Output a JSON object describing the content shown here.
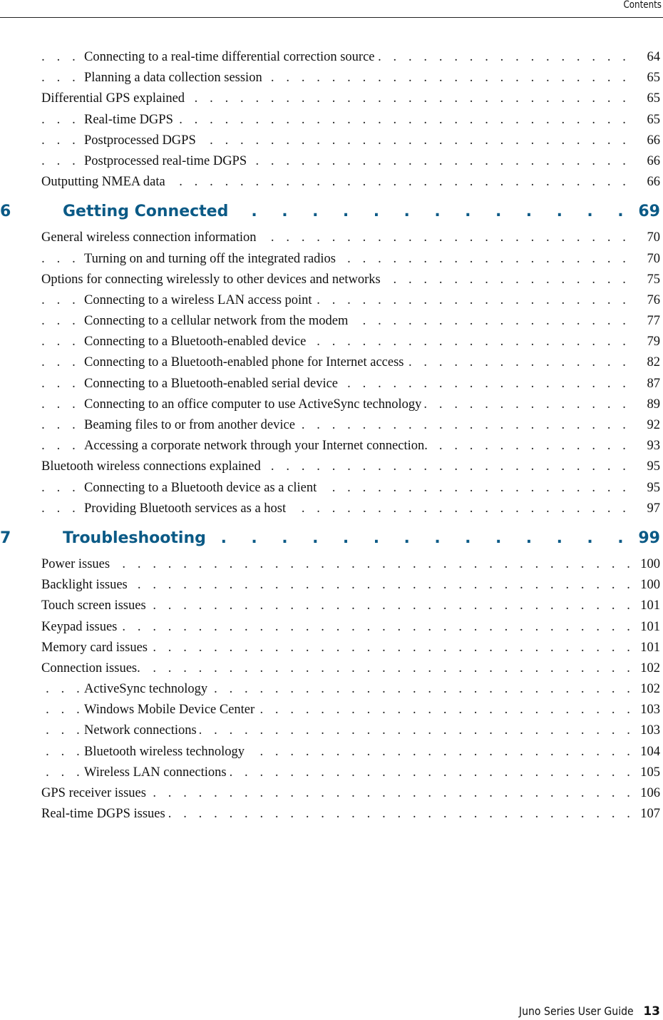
{
  "header": {
    "title": "Contents"
  },
  "toc": {
    "leader_dots": ". . . . . . . . . . . . . . . . . . . . . . . . . . . . . . . . . . . . . . . . . . . . . . . . . . . . . . . . . . . . . . . . . . . . . . . . . . . . . . . . . . . . . . . . .",
    "chapter_leader_dots": ". . . . . . . . . . . . . . . . . . . . . . . . . . . . . . . . . . . . . . . . . .",
    "accent_color": "#0b5a86",
    "pre_entries": [
      {
        "title": "Connecting to a real-time differential correction source",
        "page": "64",
        "level": 2
      },
      {
        "title": "Planning a data collection session",
        "page": "65",
        "level": 2
      },
      {
        "title": "Differential GPS explained",
        "page": "65",
        "level": 1
      },
      {
        "title": "Real-time DGPS",
        "page": "65",
        "level": 2
      },
      {
        "title": "Postprocessed DGPS",
        "page": "66",
        "level": 2
      },
      {
        "title": "Postprocessed real-time DGPS",
        "page": "66",
        "level": 2
      },
      {
        "title": "Outputting NMEA data",
        "page": "66",
        "level": 1
      }
    ],
    "chapters": [
      {
        "number": "6",
        "title": "Getting Connected",
        "page": "69",
        "entries": [
          {
            "title": "General wireless connection information",
            "page": "70",
            "level": 1
          },
          {
            "title": "Turning on and turning off the integrated radios",
            "page": "70",
            "level": 2
          },
          {
            "title": "Options for connecting wirelessly to other devices and networks",
            "page": "75",
            "level": 1
          },
          {
            "title": "Connecting to a wireless LAN access point",
            "page": "76",
            "level": 2
          },
          {
            "title": "Connecting to a cellular network from the modem",
            "page": "77",
            "level": 2
          },
          {
            "title": "Connecting to a Bluetooth-enabled device",
            "page": "79",
            "level": 2
          },
          {
            "title": "Connecting to a Bluetooth-enabled phone for Internet access",
            "page": "82",
            "level": 2
          },
          {
            "title": "Connecting to a Bluetooth-enabled serial device",
            "page": "87",
            "level": 2
          },
          {
            "title": "Connecting to an office computer to use ActiveSync technology",
            "page": "89",
            "level": 2
          },
          {
            "title": "Beaming files to or from another device",
            "page": "92",
            "level": 2
          },
          {
            "title": "Accessing a corporate network through your Internet connection.",
            "page": "93",
            "level": 2
          },
          {
            "title": "Bluetooth wireless connections explained",
            "page": "95",
            "level": 1
          },
          {
            "title": "Connecting to a Bluetooth device as a client",
            "page": "95",
            "level": 2
          },
          {
            "title": "Providing Bluetooth services as a host",
            "page": "97",
            "level": 2
          }
        ]
      },
      {
        "number": "7",
        "title": "Troubleshooting",
        "page": "99",
        "entries": [
          {
            "title": "Power issues",
            "page": "100",
            "level": 1
          },
          {
            "title": "Backlight issues",
            "page": "100",
            "level": 1
          },
          {
            "title": "Touch screen issues",
            "page": "101",
            "level": 1
          },
          {
            "title": "Keypad issues",
            "page": "101",
            "level": 1
          },
          {
            "title": "Memory card issues",
            "page": "101",
            "level": 1
          },
          {
            "title": "Connection issues.",
            "page": "102",
            "level": 1
          },
          {
            "title": "ActiveSync technology",
            "page": "102",
            "level": 2
          },
          {
            "title": "Windows Mobile Device Center",
            "page": "103",
            "level": 2
          },
          {
            "title": "Network connections",
            "page": "103",
            "level": 2
          },
          {
            "title": "Bluetooth wireless technology",
            "page": "104",
            "level": 2
          },
          {
            "title": "Wireless LAN connections",
            "page": "105",
            "level": 2
          },
          {
            "title": "GPS receiver issues",
            "page": "106",
            "level": 1
          },
          {
            "title": "Real-time DGPS issues",
            "page": "107",
            "level": 1
          }
        ]
      }
    ]
  },
  "footer": {
    "guide_title": "Juno Series User Guide",
    "page_number": "13"
  }
}
